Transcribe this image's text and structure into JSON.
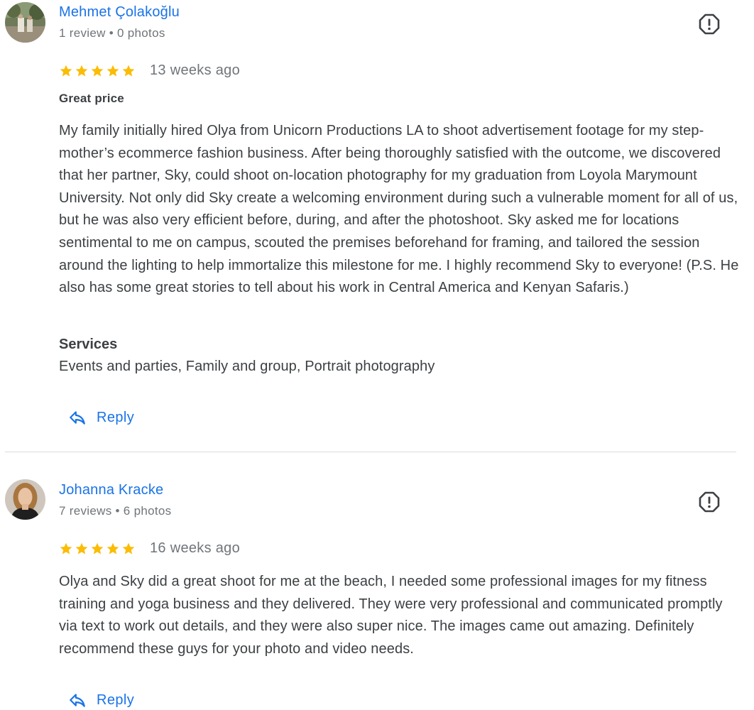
{
  "reviews": [
    {
      "author": "Mehmet Çolakoğlu",
      "meta": "1 review • 0 photos",
      "rating": 5,
      "time": "13 weeks ago",
      "title": "Great price",
      "text": "My family initially hired Olya from Unicorn Productions LA to shoot advertisement footage for my step-mother’s ecommerce fashion business. After being thoroughly satisfied with the outcome, we discovered that her partner, Sky, could shoot on-location photography for my graduation from Loyola Marymount University. Not only did Sky create a welcoming environment during such a vulnerable moment for all of us, but he was also very efficient before, during, and after the photoshoot. Sky asked me for locations sentimental to me on campus, scouted the premises beforehand for framing, and tailored the session around the lighting to help immortalize this milestone for me. I highly recommend Sky to everyone! (P.S. He also has some great stories to tell about his work in Central America and Kenyan Safaris.)",
      "services_label": "Services",
      "services": "Events and parties, Family and group, Portrait photography",
      "reply_label": "Reply",
      "avatar_icon": "avatar-photo-outdoor",
      "flag_icon": "report-flag-icon"
    },
    {
      "author": "Johanna Kracke",
      "meta": "7 reviews • 6 photos",
      "rating": 5,
      "time": "16 weeks ago",
      "text": "Olya and Sky did a great shoot for me at the beach, I needed some professional images for my fitness training and yoga business and they delivered. They were very professional and communicated promptly via text to work out details, and they were also super nice. The images came out amazing. Definitely recommend these guys for your photo and video needs.",
      "reply_label": "Reply",
      "avatar_icon": "avatar-photo-portrait",
      "flag_icon": "report-flag-icon"
    }
  ],
  "colors": {
    "link": "#1a73e8",
    "star": "#fbbc04",
    "text": "#3c4043",
    "muted": "#70757a",
    "divider": "#dadce0"
  }
}
